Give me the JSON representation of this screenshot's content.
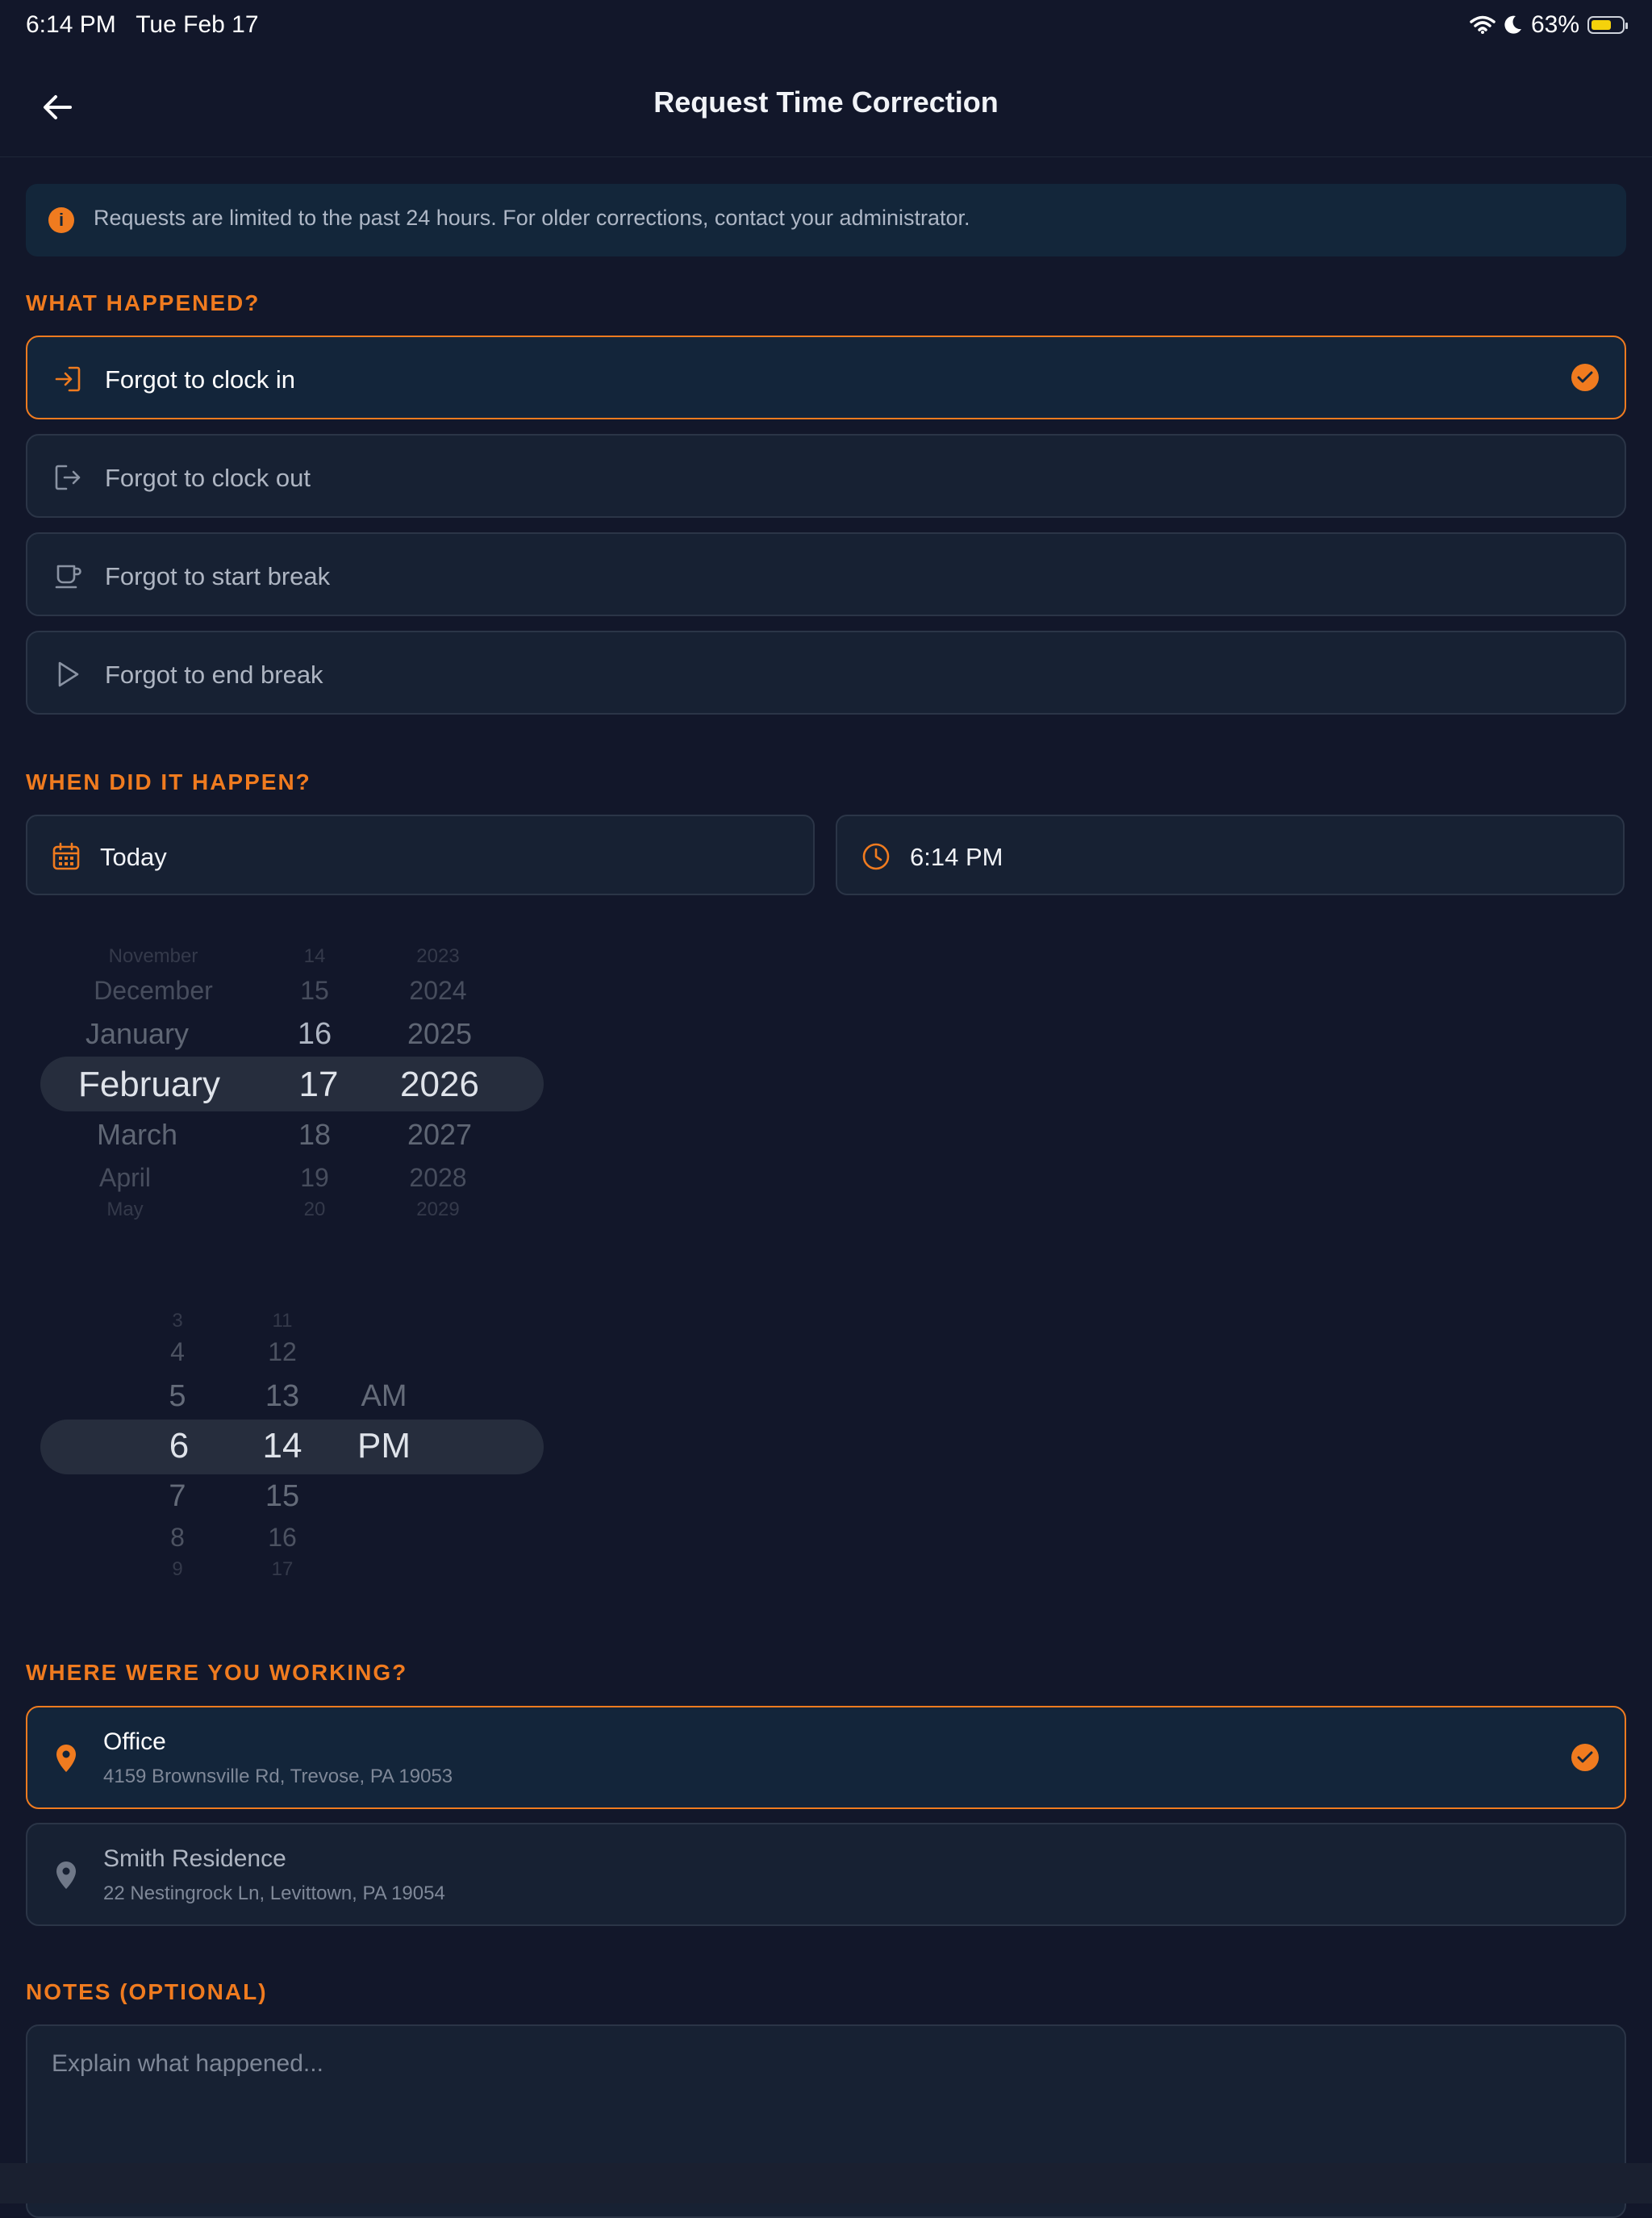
{
  "status_bar": {
    "time": "6:14 PM",
    "date": "Tue Feb 17",
    "battery": "63%"
  },
  "header": {
    "title": "Request Time Correction"
  },
  "info": {
    "text": "Requests are limited to the past 24 hours. For older corrections, contact your administrator."
  },
  "what_happened": {
    "title": "WHAT HAPPENED?",
    "options": [
      {
        "label": "Forgot to clock in",
        "icon": "clock-in-icon",
        "selected": true
      },
      {
        "label": "Forgot to clock out",
        "icon": "clock-out-icon",
        "selected": false
      },
      {
        "label": "Forgot to start break",
        "icon": "coffee-cup-icon",
        "selected": false
      },
      {
        "label": "Forgot to end break",
        "icon": "play-icon",
        "selected": false
      }
    ]
  },
  "when": {
    "title": "WHEN DID IT HAPPEN?",
    "date_value": "Today",
    "time_value": "6:14 PM"
  },
  "date_picker": {
    "months": [
      "November",
      "December",
      "January",
      "February",
      "March",
      "April",
      "May"
    ],
    "days": [
      "14",
      "15",
      "16",
      "17",
      "18",
      "19",
      "20"
    ],
    "years": [
      "2023",
      "2024",
      "2025",
      "2026",
      "2027",
      "2028",
      "2029"
    ],
    "selected_index": 3
  },
  "time_picker": {
    "hours": [
      "3",
      "4",
      "5",
      "6",
      "7",
      "8",
      "9"
    ],
    "minutes": [
      "11",
      "12",
      "13",
      "14",
      "15",
      "16",
      "17"
    ],
    "periods": [
      "AM",
      "PM"
    ],
    "selected": {
      "hour": "6",
      "minute": "14",
      "period": "PM"
    }
  },
  "where": {
    "title": "WHERE WERE YOU WORKING?",
    "locations": [
      {
        "name": "Office",
        "address": "4159 Brownsville Rd, Trevose, PA 19053",
        "selected": true
      },
      {
        "name": "Smith Residence",
        "address": "22 Nestingrock Ln, Levittown, PA 19054",
        "selected": false
      }
    ]
  },
  "notes": {
    "title": "NOTES (OPTIONAL)",
    "placeholder": "Explain what happened..."
  },
  "colors": {
    "accent": "#f07b1f",
    "background": "#12172a",
    "card": "#172133",
    "card_selected": "#13253a"
  }
}
